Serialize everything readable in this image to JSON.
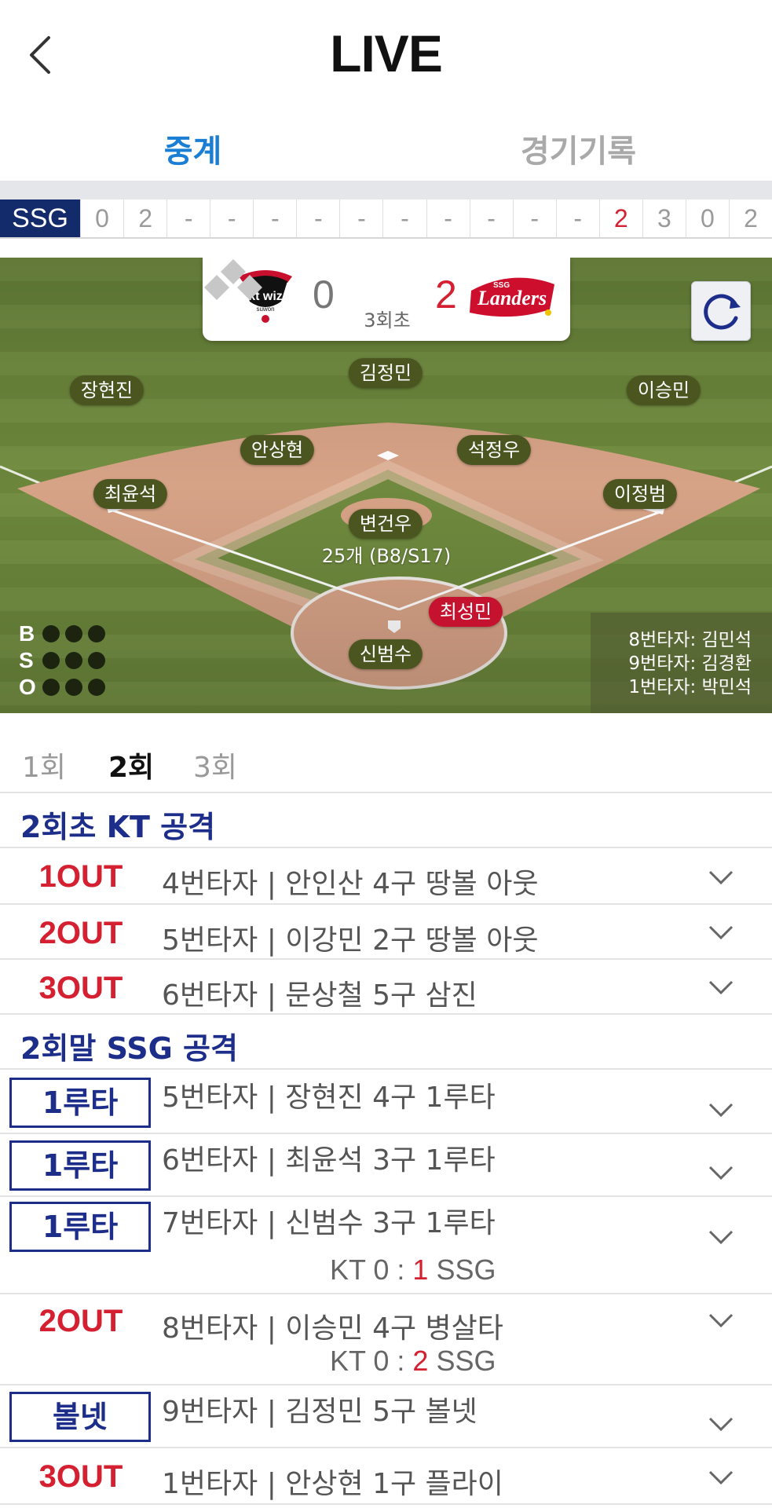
{
  "header": {
    "title": "LIVE",
    "back_icon": "chevron-left-icon"
  },
  "tabs": {
    "active": "중계",
    "inactive": "경기기록"
  },
  "scoreboard": {
    "team": "SSG",
    "cells": [
      "0",
      "2",
      "-",
      "-",
      "-",
      "-",
      "-",
      "-",
      "-",
      "-",
      "-",
      "-",
      "2",
      "3",
      "0",
      "2"
    ],
    "red_cell_index": 12
  },
  "game": {
    "away_score": "0",
    "home_score": "2",
    "inning": "3회초",
    "away_logo_text": "kt wiz",
    "away_logo_sub": "suwon",
    "home_logo_small": "SSG",
    "home_logo_text": "Landers"
  },
  "fielders": {
    "center": "김정민",
    "left": "장현진",
    "right": "이승민",
    "shortstop": "안상현",
    "second": "석정우",
    "third": "최윤석",
    "first": "이정범",
    "pitcher": "변건우",
    "catcher": "신범수",
    "runner": "최성민"
  },
  "pitch_count": "25개 (B8/S17)",
  "bso": {
    "b": "B",
    "s": "S",
    "o": "O"
  },
  "next_batters": [
    "8번타자: 김민석",
    "9번타자: 김경환",
    "1번타자: 박민석"
  ],
  "inning_tabs": [
    "1회",
    "2회",
    "3회"
  ],
  "active_inning": "2회",
  "sections": [
    {
      "title": "2회초 KT 공격",
      "plays": [
        {
          "result": "1OUT",
          "text": "4번타자 | 안인산 4구 땅볼 아웃"
        },
        {
          "result": "2OUT",
          "text": "5번타자 | 이강민 2구 땅볼 아웃"
        },
        {
          "result": "3OUT",
          "text": "6번타자 | 문상철 5구 삼진"
        }
      ]
    },
    {
      "title": "2회말 SSG 공격",
      "plays": [
        {
          "result": "1루타",
          "text": "5번타자 | 장현진 4구 1루타"
        },
        {
          "result": "1루타",
          "text": "6번타자 | 최윤석 3구 1루타"
        },
        {
          "result": "1루타",
          "text": "7번타자 | 신범수 3구 1루타",
          "score": {
            "away": "KT 0",
            "sep": ":",
            "run": "1",
            "home": "SSG"
          }
        },
        {
          "result": "2OUT",
          "text": "8번타자 | 이승민 4구 병살타",
          "score": {
            "away": "KT 0",
            "sep": ":",
            "run": "2",
            "home": "SSG"
          }
        },
        {
          "result": "볼넷",
          "text": "9번타자 | 김정민 5구 볼넷"
        },
        {
          "result": "3OUT",
          "text": "1번타자 | 안상현 1구 플라이"
        }
      ]
    }
  ],
  "colors": {
    "navy": "#1d2d8a",
    "red": "#d42031",
    "tab_blue": "#1a7fd4",
    "field_grass": "#6f8a3e",
    "infield_dirt": "#d7a387"
  }
}
